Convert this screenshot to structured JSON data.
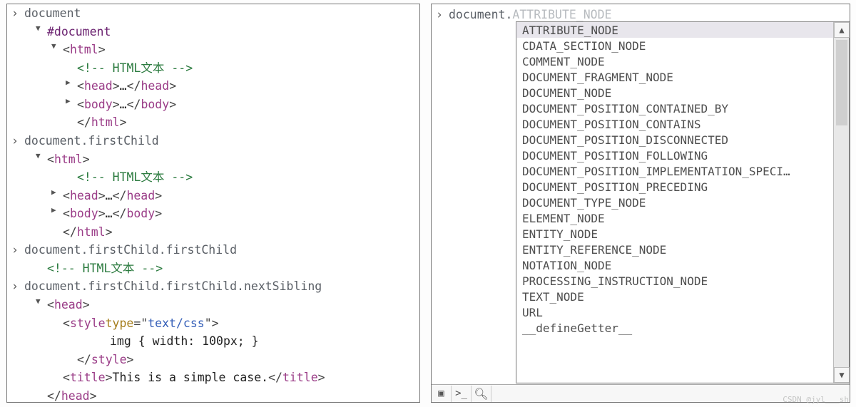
{
  "left": {
    "entries": [
      {
        "cmd": "document",
        "lines": [
          {
            "ind": "ind1",
            "tri": "down",
            "spans": [
              {
                "t": "#document",
                "cls": "sel-purple"
              }
            ]
          },
          {
            "ind": "ind2",
            "tri": "down",
            "spans": [
              {
                "t": "<",
                "cls": "punc"
              },
              {
                "t": "html",
                "cls": "tag"
              },
              {
                "t": ">",
                "cls": "punc"
              }
            ]
          },
          {
            "ind": "ind3",
            "tri": "",
            "spans": [
              {
                "t": "<!-- HTML文本 -->",
                "cls": "cmt"
              }
            ]
          },
          {
            "ind": "ind3",
            "tri": "right",
            "spans": [
              {
                "t": "<",
                "cls": "punc"
              },
              {
                "t": "head",
                "cls": "tag"
              },
              {
                "t": ">",
                "cls": "punc"
              },
              {
                "t": "…",
                "cls": "txt"
              },
              {
                "t": "</",
                "cls": "punc"
              },
              {
                "t": "head",
                "cls": "tag"
              },
              {
                "t": ">",
                "cls": "punc"
              }
            ]
          },
          {
            "ind": "ind3",
            "tri": "right",
            "spans": [
              {
                "t": "<",
                "cls": "punc"
              },
              {
                "t": "body",
                "cls": "tag"
              },
              {
                "t": ">",
                "cls": "punc"
              },
              {
                "t": "…",
                "cls": "txt"
              },
              {
                "t": "</",
                "cls": "punc"
              },
              {
                "t": "body",
                "cls": "tag"
              },
              {
                "t": ">",
                "cls": "punc"
              }
            ]
          },
          {
            "ind": "ind3",
            "tri": "",
            "spans": [
              {
                "t": "</",
                "cls": "punc"
              },
              {
                "t": "html",
                "cls": "tag"
              },
              {
                "t": ">",
                "cls": "punc"
              }
            ]
          }
        ]
      },
      {
        "cmd": "document.firstChild",
        "lines": [
          {
            "ind": "ind1",
            "tri": "down",
            "spans": [
              {
                "t": "<",
                "cls": "punc"
              },
              {
                "t": "html",
                "cls": "tag"
              },
              {
                "t": ">",
                "cls": "punc"
              }
            ]
          },
          {
            "ind": "ind3",
            "tri": "",
            "spans": [
              {
                "t": "<!-- HTML文本 -->",
                "cls": "cmt"
              }
            ]
          },
          {
            "ind": "ind2",
            "tri": "right",
            "spans": [
              {
                "t": "<",
                "cls": "punc"
              },
              {
                "t": "head",
                "cls": "tag"
              },
              {
                "t": ">",
                "cls": "punc"
              },
              {
                "t": "…",
                "cls": "txt"
              },
              {
                "t": "</",
                "cls": "punc"
              },
              {
                "t": "head",
                "cls": "tag"
              },
              {
                "t": ">",
                "cls": "punc"
              }
            ]
          },
          {
            "ind": "ind2",
            "tri": "right",
            "spans": [
              {
                "t": "<",
                "cls": "punc"
              },
              {
                "t": "body",
                "cls": "tag"
              },
              {
                "t": ">",
                "cls": "punc"
              },
              {
                "t": "…",
                "cls": "txt"
              },
              {
                "t": "</",
                "cls": "punc"
              },
              {
                "t": "body",
                "cls": "tag"
              },
              {
                "t": ">",
                "cls": "punc"
              }
            ]
          },
          {
            "ind": "ind2",
            "tri": "",
            "spans": [
              {
                "t": "</",
                "cls": "punc"
              },
              {
                "t": "html",
                "cls": "tag"
              },
              {
                "t": ">",
                "cls": "punc"
              }
            ]
          }
        ]
      },
      {
        "cmd": "document.firstChild.firstChild",
        "lines": [
          {
            "ind": "ind1",
            "tri": "",
            "spans": [
              {
                "t": "<!-- HTML文本 -->",
                "cls": "cmt"
              }
            ]
          }
        ]
      },
      {
        "cmd": "document.firstChild.firstChild.nextSibling",
        "lines": [
          {
            "ind": "ind1",
            "tri": "down",
            "spans": [
              {
                "t": "<",
                "cls": "punc"
              },
              {
                "t": "head",
                "cls": "tag"
              },
              {
                "t": ">",
                "cls": "punc"
              }
            ]
          },
          {
            "ind": "ind2",
            "tri": "",
            "spans": [
              {
                "t": "<",
                "cls": "punc"
              },
              {
                "t": "style",
                "cls": "tag"
              },
              {
                "t": " ",
                "cls": "punc"
              },
              {
                "t": "type",
                "cls": "attrn"
              },
              {
                "t": "=\"",
                "cls": "punc"
              },
              {
                "t": "text/css",
                "cls": "attrv"
              },
              {
                "t": "\">",
                "cls": "punc"
              }
            ]
          },
          {
            "ind": "ind5",
            "tri": "",
            "spans": [
              {
                "t": "img { width: 100px; }",
                "cls": "txt"
              }
            ]
          },
          {
            "ind": "ind3",
            "tri": "",
            "spans": [
              {
                "t": "</",
                "cls": "punc"
              },
              {
                "t": "style",
                "cls": "tag"
              },
              {
                "t": ">",
                "cls": "punc"
              }
            ]
          },
          {
            "ind": "ind2",
            "tri": "",
            "spans": [
              {
                "t": "<",
                "cls": "punc"
              },
              {
                "t": "title",
                "cls": "tag"
              },
              {
                "t": ">",
                "cls": "punc"
              },
              {
                "t": "This is a simple case.",
                "cls": "txt"
              },
              {
                "t": "</",
                "cls": "punc"
              },
              {
                "t": "title",
                "cls": "tag"
              },
              {
                "t": ">",
                "cls": "punc"
              }
            ]
          },
          {
            "ind": "ind1",
            "tri": "",
            "spans": [
              {
                "t": "</",
                "cls": "punc"
              },
              {
                "t": "head",
                "cls": "tag"
              },
              {
                "t": ">",
                "cls": "punc"
              }
            ]
          }
        ]
      }
    ]
  },
  "right": {
    "typed": "document.",
    "ghost": "ATTRIBUTE_NODE",
    "items": [
      "ATTRIBUTE_NODE",
      "CDATA_SECTION_NODE",
      "COMMENT_NODE",
      "DOCUMENT_FRAGMENT_NODE",
      "DOCUMENT_NODE",
      "DOCUMENT_POSITION_CONTAINED_BY",
      "DOCUMENT_POSITION_CONTAINS",
      "DOCUMENT_POSITION_DISCONNECTED",
      "DOCUMENT_POSITION_FOLLOWING",
      "DOCUMENT_POSITION_IMPLEMENTATION_SPECI…",
      "DOCUMENT_POSITION_PRECEDING",
      "DOCUMENT_TYPE_NODE",
      "ELEMENT_NODE",
      "ENTITY_NODE",
      "ENTITY_REFERENCE_NODE",
      "NOTATION_NODE",
      "PROCESSING_INSTRUCTION_NODE",
      "TEXT_NODE",
      "URL",
      "__defineGetter__"
    ],
    "selected": 0
  },
  "toolbar_icons": [
    "square-icon",
    "console-icon",
    "search-icon"
  ],
  "watermark": "CSDN @jyl___sh"
}
